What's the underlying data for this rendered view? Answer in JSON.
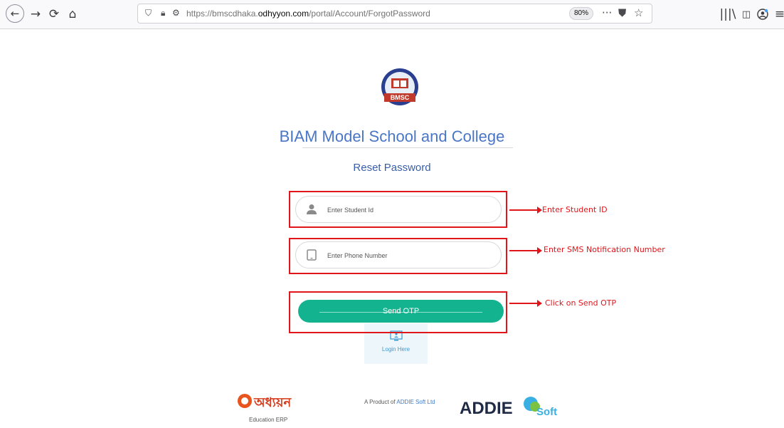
{
  "browser": {
    "url_prefix": "https://bmscdhaka.",
    "url_domain": "odhyyon.com",
    "url_path": "/portal/Account/ForgotPassword",
    "zoom": "80%",
    "overflow_menu_label": "···"
  },
  "page": {
    "logo_text": "BMSC",
    "school_name": "BIAM Model School and College",
    "heading": "Reset Password",
    "student_id_placeholder": "Enter Student Id",
    "phone_placeholder": "Enter Phone Number",
    "send_otp_label": "Send OTP",
    "login_label": "Login Here"
  },
  "annotations": {
    "student_id": "Enter Student ID",
    "phone": "Enter SMS Notification Number",
    "send_otp": "Click on Send OTP"
  },
  "footer": {
    "left_logo_text": "অধ্যয়ন",
    "left_logo_subtitle": "Education ERP",
    "product_text_prefix": "A Product of ",
    "product_company": "ADDIE Soft Ltd",
    "right_logo_main": "ADDIE",
    "right_logo_suffix": "Soft"
  },
  "colors": {
    "accent_green": "#14b38f",
    "title_blue": "#4a76c6",
    "annotation_red": "#e0161b"
  }
}
